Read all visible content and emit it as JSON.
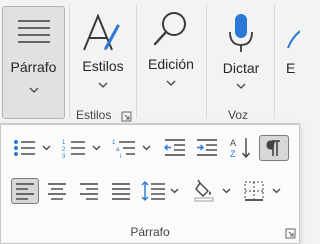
{
  "ribbon": {
    "groups": [
      {
        "name": "parrafo",
        "button_label": "Párrafo"
      },
      {
        "name": "estilos",
        "button_label": "Estilos",
        "group_label": "Estilos"
      },
      {
        "name": "edicion",
        "button_label": "Edición"
      },
      {
        "name": "voz",
        "button_label": "Dictar",
        "group_label": "Voz"
      },
      {
        "name": "editor",
        "button_label": "E"
      }
    ]
  },
  "popup": {
    "title": "Párrafo",
    "tools": [
      "bullets",
      "numbering",
      "multilevel-list",
      "decrease-indent",
      "increase-indent",
      "sort",
      "show-formatting-marks",
      "align-left",
      "center",
      "align-right",
      "justify",
      "line-spacing",
      "shading",
      "borders"
    ],
    "selected": [
      "show-formatting-marks",
      "align-left"
    ]
  },
  "colors": {
    "accent": "#2b78d7",
    "ink": "#262626",
    "muted": "#555555"
  }
}
